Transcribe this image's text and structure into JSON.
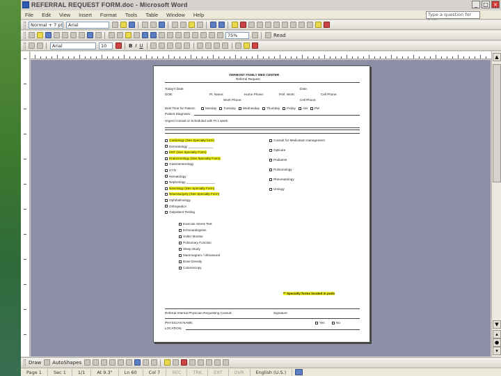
{
  "window": {
    "title": "REFERRAL REQUEST FORM.doc - Microsoft Word",
    "help_placeholder": "Type a question for help"
  },
  "menu": [
    "File",
    "Edit",
    "View",
    "Insert",
    "Format",
    "Tools",
    "Table",
    "Window",
    "Help"
  ],
  "toolbar1": {
    "style": "Normal + 7 pt",
    "font": "Arial"
  },
  "toolbar2": {
    "zoom": "75%",
    "read_label": "Read"
  },
  "toolbar3": {
    "font": "Arial",
    "size": "10"
  },
  "form": {
    "header1": "VERMONT FAMILY MED CENTER",
    "header2": "Referral Request",
    "r1": [
      "Today's Date:",
      "Date:"
    ],
    "r2": [
      "DOB:",
      "Pt. Name:",
      "Home Phone:",
      "Pref. Work:",
      "Cell Phone:"
    ],
    "r3": [
      "Work Phone:",
      "Cell Phone:"
    ],
    "days_label": "Best Time for Patient:",
    "days": [
      "Monday",
      "Tuesday",
      "Wednesday",
      "Thursday",
      "Friday",
      "AM",
      "PM"
    ],
    "diag": "Patient Diagnosis:",
    "urgent": "Urgent Consult or Scheduled with Pt 1 week:",
    "left": [
      {
        "t": "Cardiology (See Specialty form)",
        "hl": true
      },
      {
        "t": "Dermatology ______________",
        "hl": false
      },
      {
        "t": "ENT (See Specialty Form)",
        "hl": true
      },
      {
        "t": "Endocrinology (See Specialty Form)",
        "hl": true
      },
      {
        "t": "Gastroenterology",
        "hl": false
      },
      {
        "t": "GYN",
        "hl": false
      },
      {
        "t": "Hematology",
        "hl": false
      },
      {
        "t": "Nephrology ________________",
        "hl": false
      },
      {
        "t": "Neurology (See Specialty Form)",
        "hl": true
      },
      {
        "t": "Neurosurgery (See Specialty Form)",
        "hl": true
      },
      {
        "t": "Ophthalmology",
        "hl": false
      },
      {
        "t": "Orthopedics",
        "hl": false
      },
      {
        "t": "Outpatient Testing",
        "hl": false
      }
    ],
    "right": [
      "Consult for Medication management",
      "Opticare",
      "Podiatrist",
      "Pulmonology",
      "Rheumatology",
      "Urology"
    ],
    "testing": [
      "Exercise Stress Test",
      "Echocardiogram",
      "Holter Monitor",
      "Pulmonary Function",
      "Sleep Study",
      "Mammogram / Ultrasound",
      "Bone Density",
      "Colonoscopy"
    ],
    "specialty_note": "** Specialty forms located in pods",
    "physician": "Referral Internal Physician Requesting Consult:",
    "signature": "Signature:",
    "phys_name": "PHYSICIAN NAME:",
    "location": "LOCATION:",
    "yes": "Yes",
    "no": "No"
  },
  "drawbar": {
    "draw": "Draw",
    "autoshapes": "AutoShapes"
  },
  "status": {
    "page": "Page 1",
    "sec": "Sec 1",
    "pos": "1/1",
    "at": "At 9.3\"",
    "ln": "Ln 60",
    "col": "Col 7",
    "rec": "REC",
    "trk": "TRK",
    "ext": "EXT",
    "ovr": "OVR",
    "lang": "English (U.S.)"
  }
}
